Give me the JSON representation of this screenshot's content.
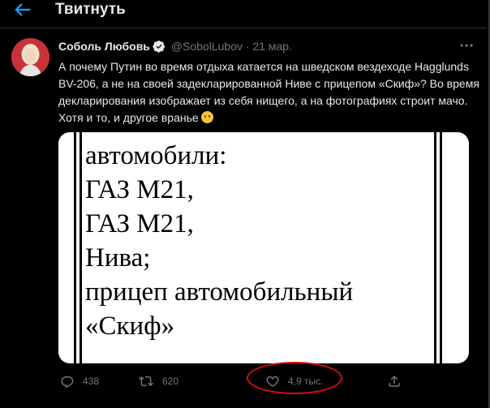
{
  "header": {
    "title": "Твитнуть"
  },
  "tweet": {
    "author_name": "Соболь Любовь",
    "handle": "@SobolLubov",
    "separator": "·",
    "date": "21 мар.",
    "text": "А почему Путин во время отдыха катается на шведском вездеходе Hagglunds BV-206, а не на своей задекларированной Ниве с прицепом «Скиф»? Во время декларирования изображает из себя нищего, а на фотографиях строит мачо. Хотя и то, и другое вранье",
    "emoji": "face-with-raised-eyebrow-emoji",
    "media_lines": [
      "автомобили:",
      "ГАЗ М21,",
      "ГАЗ М21,",
      "Нива;",
      "прицеп автомобильный",
      "«Скиф»"
    ]
  },
  "actions": {
    "reply_count": "438",
    "retweet_count": "620",
    "like_count": "4,9 тыс.",
    "share_label": ""
  },
  "colors": {
    "background": "#000000",
    "accent": "#1d9bf0",
    "muted": "#71767b",
    "annotation": "#d60d12"
  }
}
